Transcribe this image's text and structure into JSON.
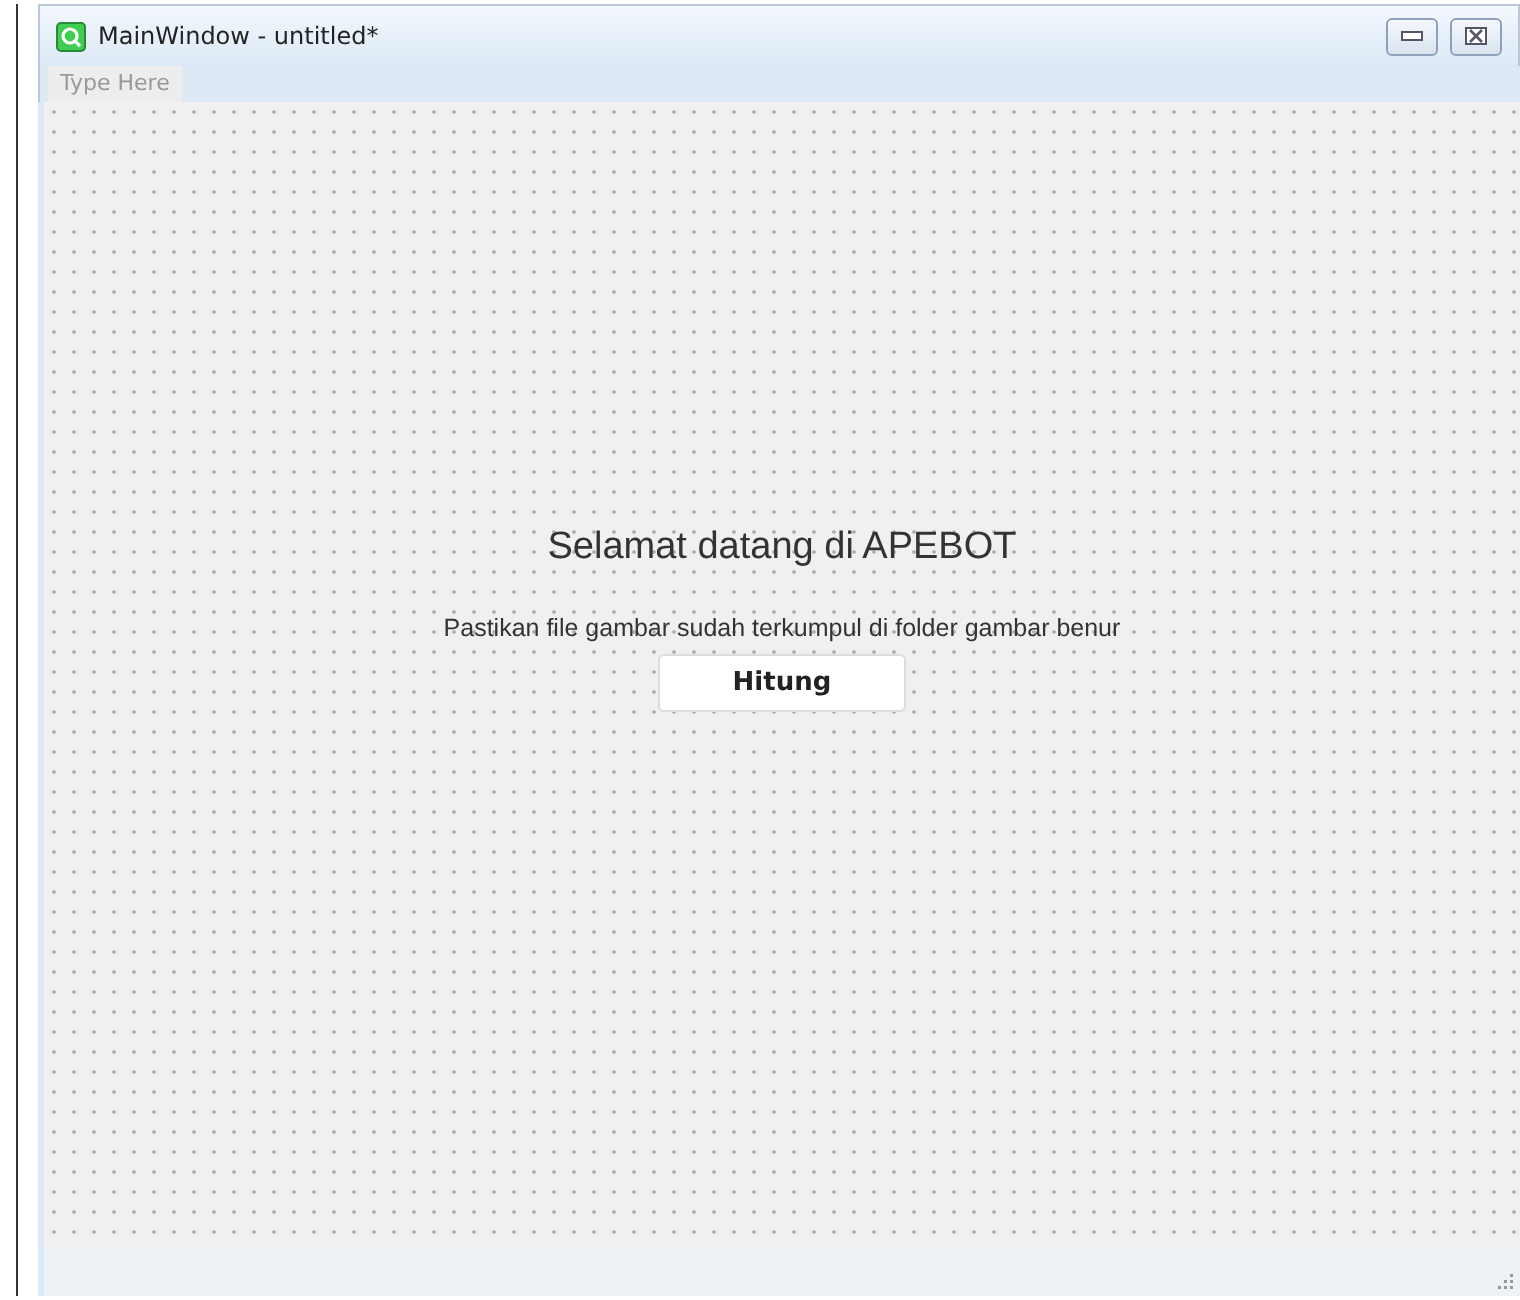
{
  "window": {
    "title": "MainWindow - untitled*"
  },
  "menu_bar": {
    "placeholder": "Type Here"
  },
  "form": {
    "heading": "Selamat datang di APEBOT",
    "instruction": "Pastikan file gambar sudah terkumpul di folder gambar benur",
    "button": "Hitung"
  }
}
